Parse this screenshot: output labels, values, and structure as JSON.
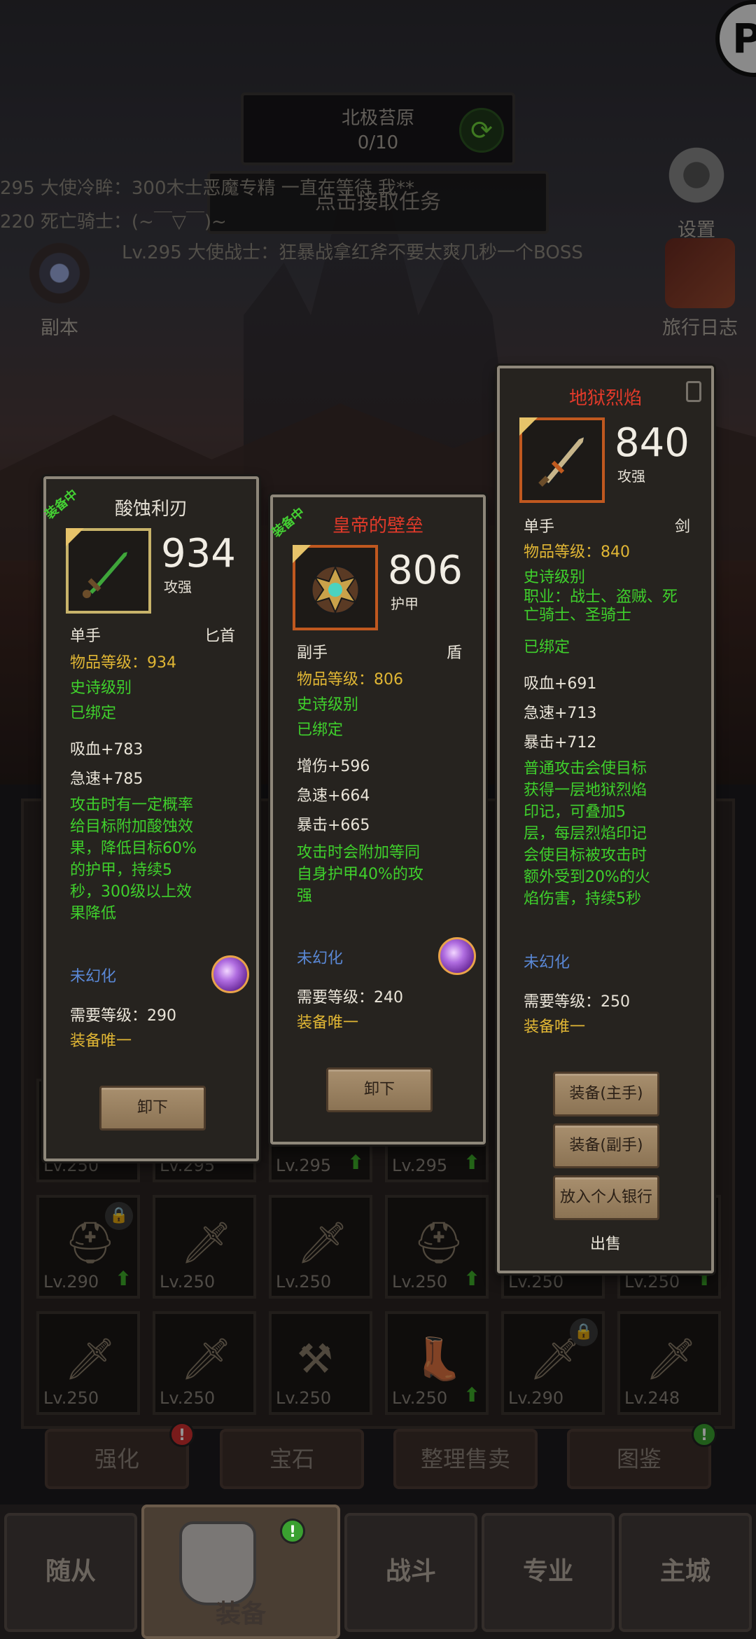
{
  "top": {
    "quest_title": "北极苔原",
    "quest_count": "0/10",
    "accept_label": "点击接取任务"
  },
  "chat": [
    "295 大使冷眸：300木士恶魔专精 一直在等待 我**",
    "220 死亡骑士：(~￣▽￣)~",
    "Lv.295 大使战士：狂暴战拿红斧不要太爽几秒一个BOSS"
  ],
  "side": {
    "settings": "设置",
    "dungeon": "副本",
    "journal": "旅行日志"
  },
  "cards": [
    {
      "equipped": "装备中",
      "name": "酸蚀利刃",
      "name_color": "#e6e1d6",
      "value": "934",
      "value_label": "攻强",
      "hand": "单手",
      "type": "匕首",
      "item_level": "物品等级：934",
      "quality": "史诗级别",
      "bound": "已绑定",
      "stats": [
        "吸血+783",
        "急速+785"
      ],
      "effect": "攻击时有一定概率\n给目标附加酸蚀效\n果，降低目标60%\n的护甲，持续5\n秒，300级以上效\n果降低",
      "transmog": "未幻化",
      "req_level": "需要等级：290",
      "unique": "装备唯一",
      "button": "卸下"
    },
    {
      "equipped": "装备中",
      "name": "皇帝的壁垒",
      "name_color": "#e23a2a",
      "value": "806",
      "value_label": "护甲",
      "hand": "副手",
      "type": "盾",
      "item_level": "物品等级：806",
      "quality": "史诗级别",
      "bound": "已绑定",
      "stats": [
        "增伤+596",
        "急速+664",
        "暴击+665"
      ],
      "effect": "攻击时会附加等同\n自身护甲40%的攻\n强",
      "transmog": "未幻化",
      "req_level": "需要等级：240",
      "unique": "装备唯一",
      "button": "卸下"
    },
    {
      "name": "地狱烈焰",
      "name_color": "#e23a2a",
      "value": "840",
      "value_label": "攻强",
      "hand": "单手",
      "type": "剑",
      "item_level": "物品等级：840",
      "quality": "史诗级别",
      "classes": "职业：战士、盗贼、死\n亡骑士、圣骑士",
      "bound": "已绑定",
      "stats": [
        "吸血+691",
        "急速+713",
        "暴击+712"
      ],
      "effect": "普通攻击会使目标\n获得一层地狱烈焰\n印记，可叠加5\n层，每层烈焰印记\n会使目标被攻击时\n额外受到20%的火\n焰伤害，持续5秒",
      "transmog": "未幻化",
      "req_level": "需要等级：250",
      "unique": "装备唯一",
      "buttons": [
        "装备(主手)",
        "装备(副手)",
        "放入个人银行"
      ],
      "sell": "出售"
    }
  ],
  "inventory": {
    "row1": [
      "Lv.250",
      "Lv.295",
      "Lv.295",
      "Lv.295"
    ],
    "row2": [
      "Lv.290",
      "Lv.250",
      "Lv.250",
      "Lv.250",
      "Lv.250",
      "Lv.250"
    ],
    "row3": [
      "Lv.250",
      "Lv.250",
      "Lv.250",
      "Lv.250",
      "Lv.290",
      "Lv.248"
    ]
  },
  "actions": [
    "强化",
    "宝石",
    "整理售卖",
    "图鉴"
  ],
  "nav": [
    "随从",
    "装备",
    "战斗",
    "专业",
    "主城"
  ],
  "colors": {
    "epic_green": "#3fd02c",
    "gold": "#e0b634",
    "red": "#e23a2a",
    "blue": "#5a88d6"
  }
}
